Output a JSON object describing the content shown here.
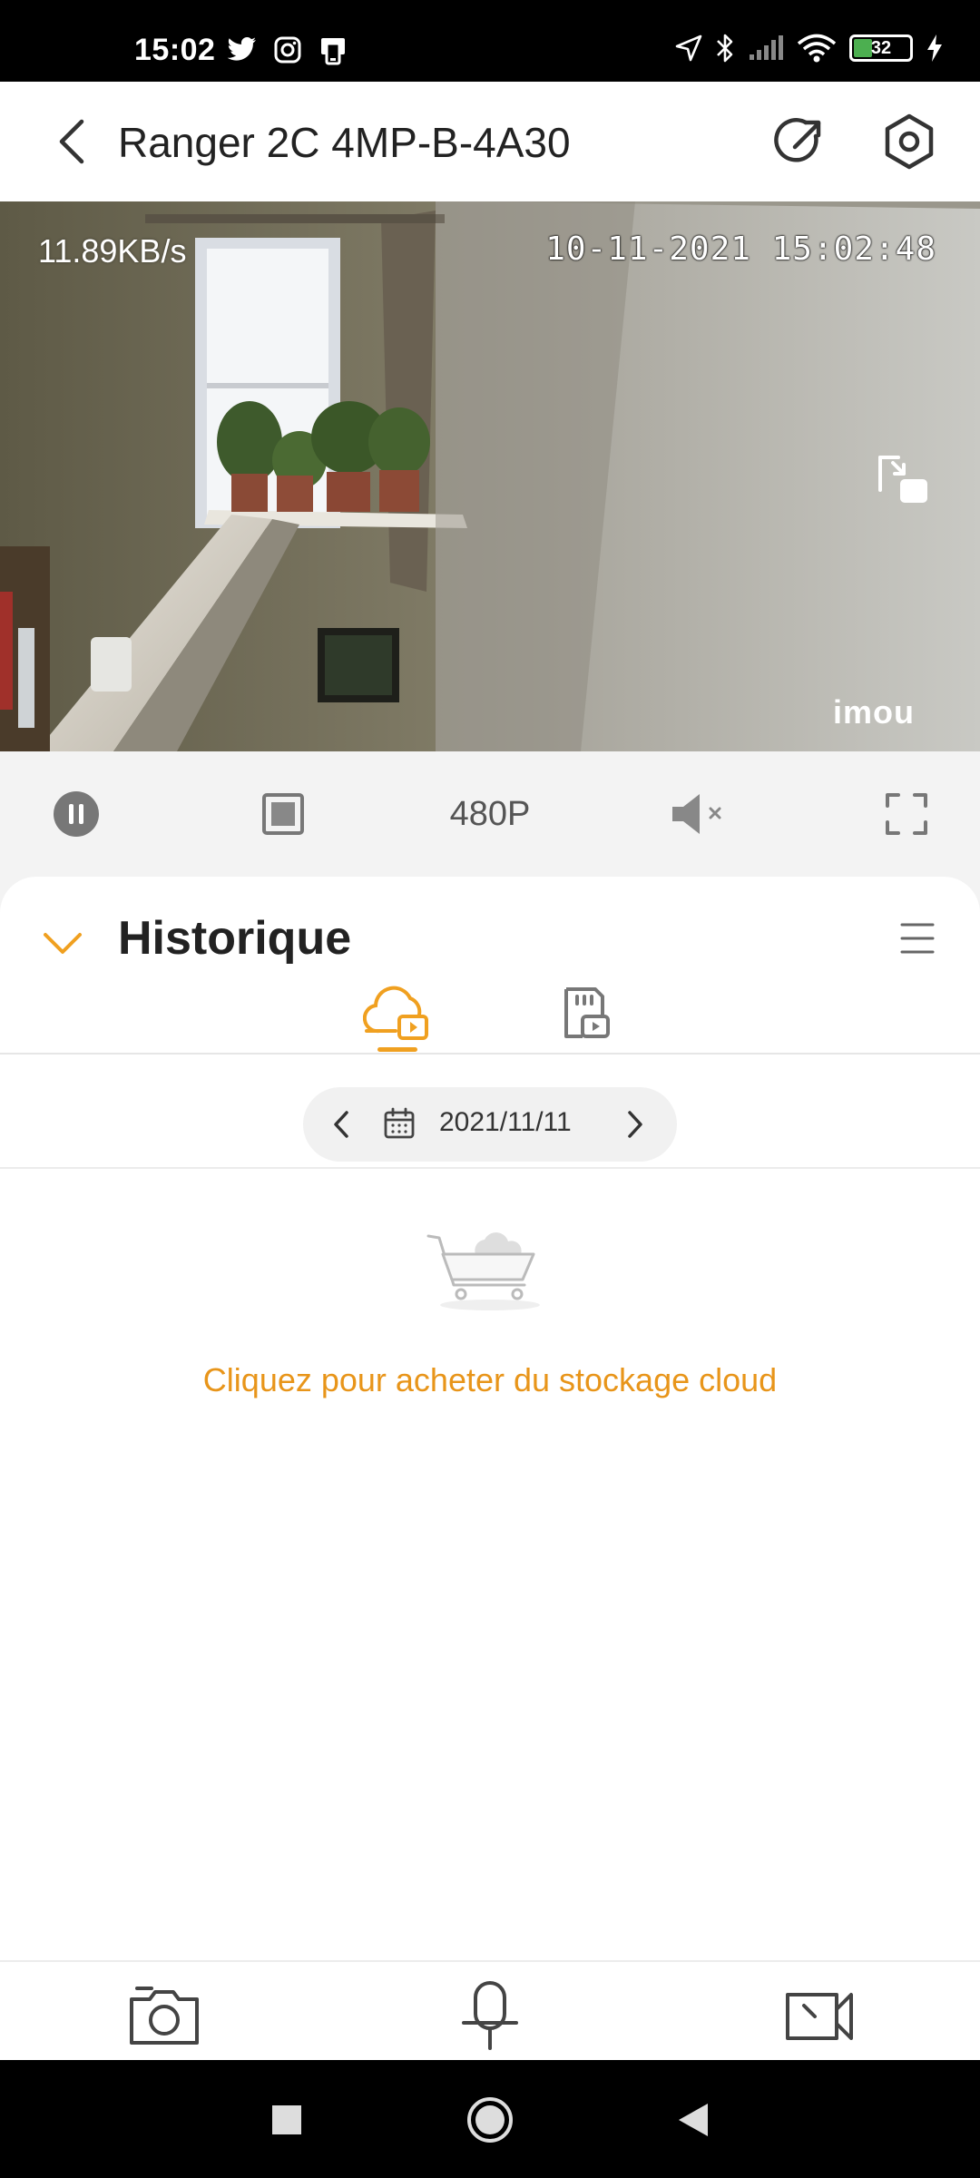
{
  "status_bar": {
    "time": "15:02",
    "left_icons": [
      "twitter-icon",
      "instagram-icon",
      "phone-notification-icon"
    ],
    "right_icons": [
      "location-arrow-icon",
      "bluetooth-icon",
      "signal-icon",
      "wifi-icon",
      "battery-icon",
      "charging-bolt-icon"
    ],
    "battery_percent": "32"
  },
  "header": {
    "title": "Ranger 2C 4MP-B-4A30",
    "back_icon": "chevron-left-icon",
    "share_icon": "share-arrow-icon",
    "settings_icon": "settings-hexagon-icon"
  },
  "video": {
    "bitrate": "11.89KB/s",
    "timestamp": "10-11-2021 15:02:48",
    "watermark": "imou"
  },
  "controls": {
    "pause_icon": "pause-icon",
    "stop_icon": "stop-icon",
    "quality": "480P",
    "mute_icon": "mute-icon",
    "fullscreen_icon": "fullscreen-icon"
  },
  "history": {
    "title": "Historique",
    "tabs": [
      {
        "icon": "cloud-video-icon",
        "active": true
      },
      {
        "icon": "sd-card-video-icon",
        "active": false
      }
    ],
    "date": "2021/11/11",
    "empty_action": "Cliquez pour acheter du stockage cloud"
  },
  "toolbar": {
    "buttons": [
      "camera-snapshot-icon",
      "microphone-icon",
      "video-record-icon"
    ]
  },
  "colors": {
    "accent": "#f0a020",
    "link": "#e8951a"
  }
}
